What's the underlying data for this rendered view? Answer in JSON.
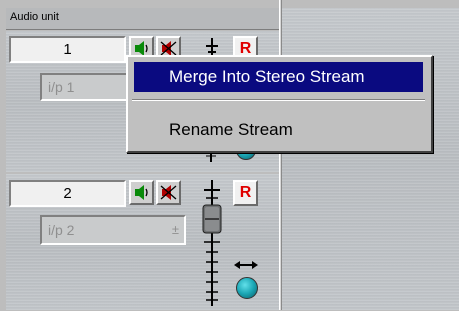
{
  "header": {
    "title": "Audio unit"
  },
  "strips": [
    {
      "number": "1",
      "input": "i/p 1",
      "record_label": "R"
    },
    {
      "number": "2",
      "input": "i/p 2",
      "record_label": "R"
    }
  ],
  "context_menu": {
    "items": [
      {
        "label": "Merge Into Stereo Stream",
        "selected": true
      },
      {
        "label": "Rename Stream",
        "selected": false
      }
    ]
  },
  "colors": {
    "menu_highlight": "#0a0a80",
    "record_red": "#e00000",
    "knob_teal": "#1aa6b4"
  }
}
